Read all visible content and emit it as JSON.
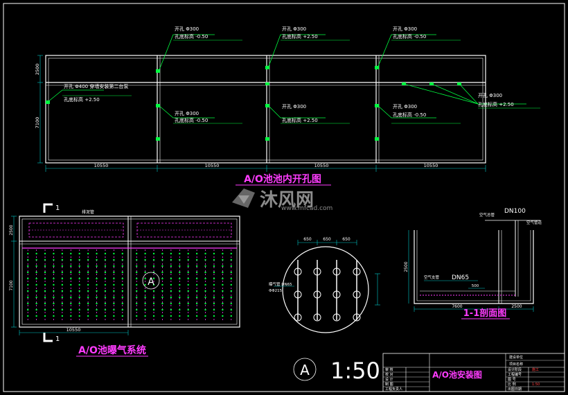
{
  "top_plan": {
    "title": "A/O池池内开孔图",
    "callouts": [
      {
        "hole": "开孔 Φ300",
        "level": "孔底标高 -0.50"
      },
      {
        "hole": "开孔 Φ300",
        "level": "孔底标高 +2.50"
      },
      {
        "hole": "开孔 Φ300",
        "level": "孔底标高 -0.50"
      },
      {
        "hole": "开孔 Φ400  穿墙安装第二台泵",
        "level": "孔底标高 +2.50"
      },
      {
        "hole": "开孔 Φ300",
        "level": "孔底标高 -0.50"
      },
      {
        "hole": "开孔 Φ300",
        "level": "孔底标高 +2.50"
      },
      {
        "hole": "开孔 Φ300",
        "level": "孔底标高 -0.50"
      },
      {
        "hole": "开孔 Φ300",
        "level": "孔底标高 +2.50"
      }
    ],
    "dims_bottom": [
      "10550",
      "10550",
      "10550",
      "10550"
    ],
    "dims_left": [
      "2500",
      "7100"
    ]
  },
  "watermark": {
    "brand": "沐风网",
    "url": "www.mfcad.com"
  },
  "aeration": {
    "title": "A/O池曝气系统",
    "section_mark": "1",
    "circle_label": "A",
    "top_label": "排泥管",
    "dim_bottom": "10550",
    "dims_left": [
      "2500",
      "7100"
    ]
  },
  "detail_a": {
    "dims_top": [
      "650",
      "650",
      "650"
    ],
    "left_label_1": "曝气管 DN65",
    "left_label_2": "ΦΦ215"
  },
  "section": {
    "title": "1-1剖面图",
    "label_dn100": "DN100",
    "label_dn65": "DN65",
    "label_air": "空气管道",
    "label_air2": "空气总管",
    "label_air3": "空气主管",
    "label_air4": "空气支管",
    "dim_500": "500",
    "dim_left": "2500",
    "dims_bottom": [
      "7600",
      "2500"
    ]
  },
  "scale": {
    "circle": "A",
    "text": "1:50"
  },
  "title_block": {
    "drawing_name": "A/O池安装图",
    "left_rows": [
      "审  核",
      "校  对",
      "设  计",
      "制  图",
      "工程负责人"
    ],
    "mid_labels": [
      "建设单位",
      "项目名称"
    ],
    "right_rows": [
      "设计阶段",
      "工程编号",
      "图  号",
      "比  例",
      "出图日期"
    ],
    "right_values": [
      "施工",
      "",
      "",
      "1:50",
      ""
    ]
  }
}
